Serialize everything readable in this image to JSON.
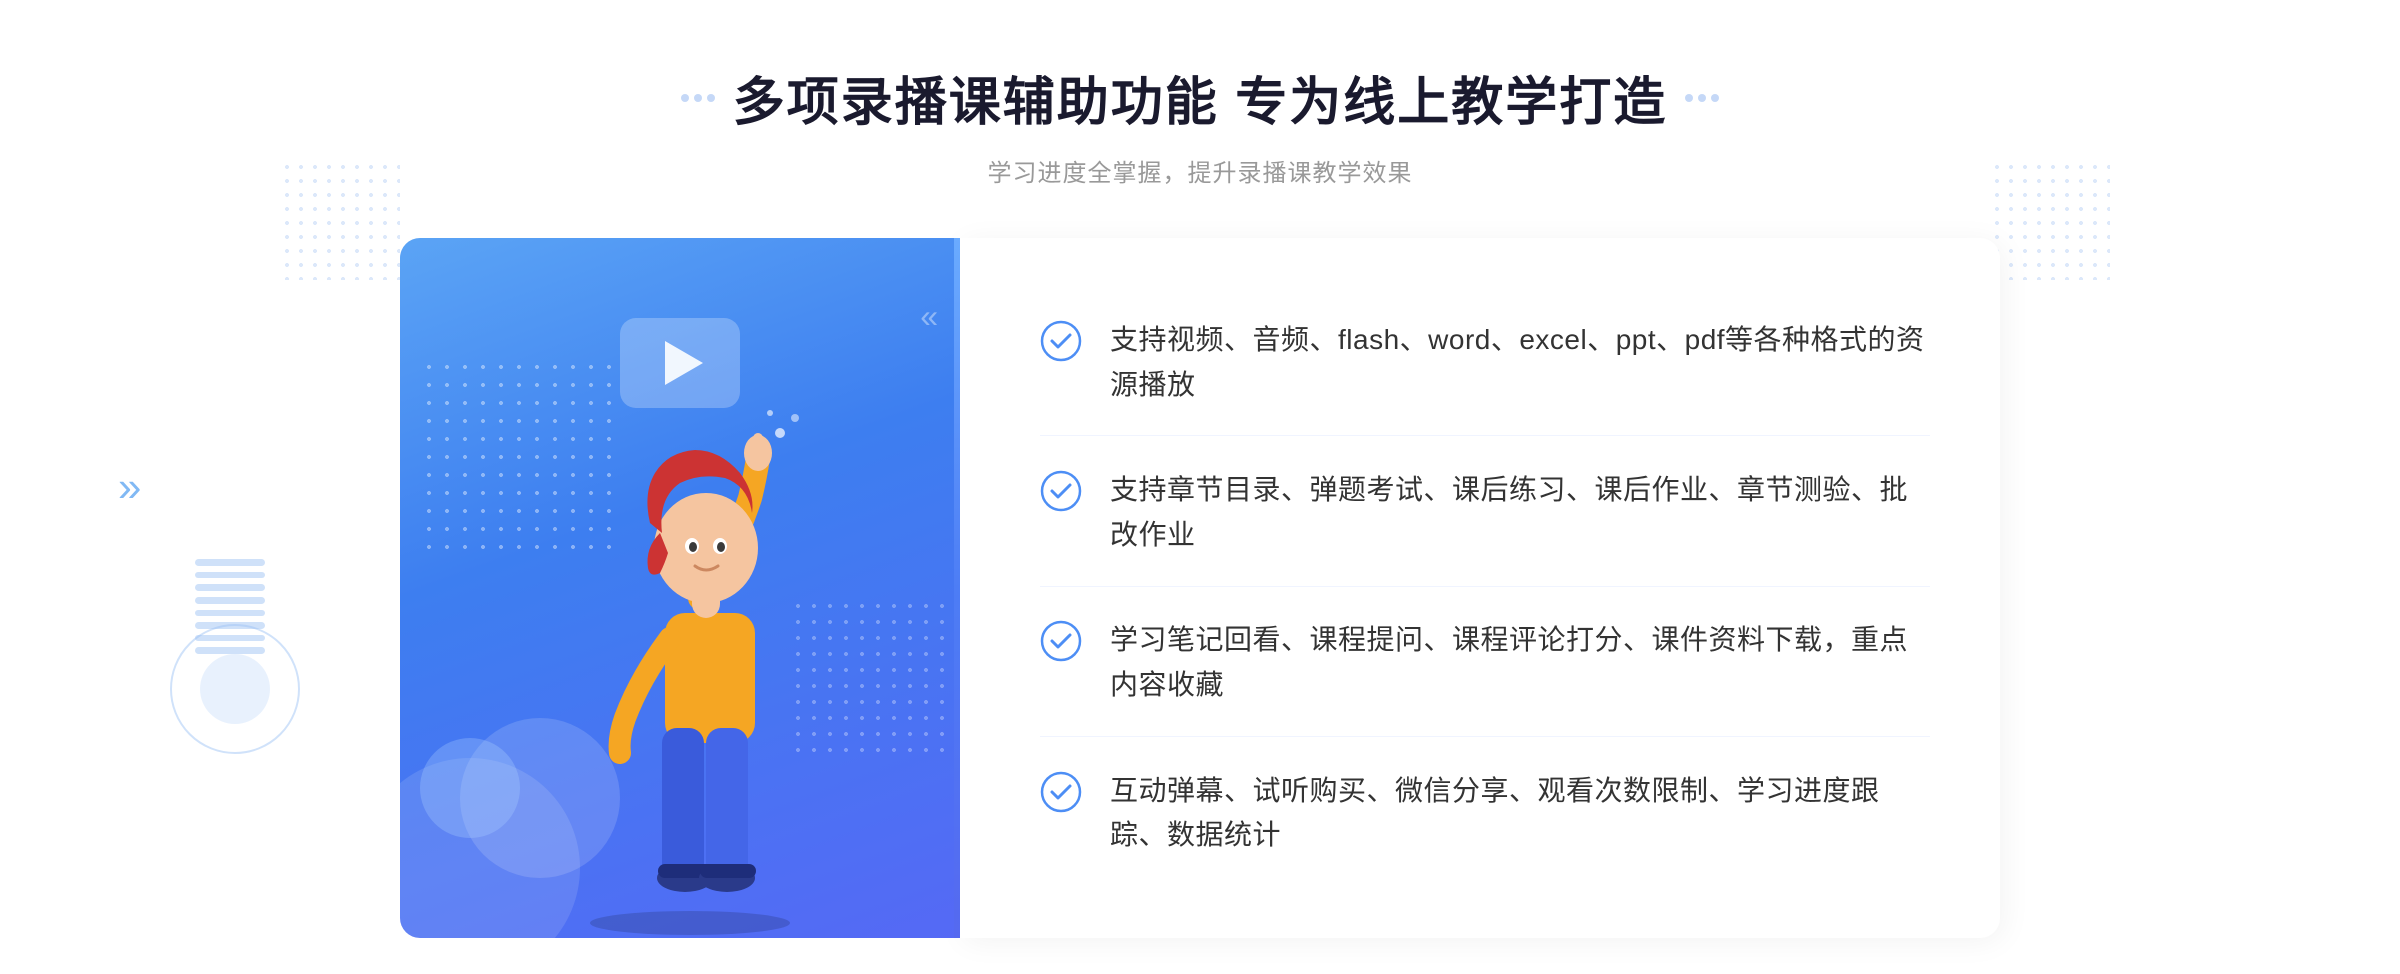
{
  "header": {
    "main_title": "多项录播课辅助功能 专为线上教学打造",
    "subtitle": "学习进度全掌握，提升录播课教学效果",
    "title_dots_left": "decorative",
    "title_dots_right": "decorative"
  },
  "features": [
    {
      "id": 1,
      "text": "支持视频、音频、flash、word、excel、ppt、pdf等各种格式的资源播放"
    },
    {
      "id": 2,
      "text": "支持章节目录、弹题考试、课后练习、课后作业、章节测验、批改作业"
    },
    {
      "id": 3,
      "text": "学习笔记回看、课程提问、课程评论打分、课件资料下载，重点内容收藏"
    },
    {
      "id": 4,
      "text": "互动弹幕、试听购买、微信分享、观看次数限制、学习进度跟踪、数据统计"
    }
  ],
  "colors": {
    "primary_blue": "#4d8ef5",
    "accent_blue": "#5569f5",
    "light_blue": "#a0c4f5",
    "text_dark": "#1a1a2e",
    "text_gray": "#999999",
    "text_body": "#333333",
    "white": "#ffffff",
    "check_color": "#4d8ef5"
  },
  "chevron_left_label": "»"
}
